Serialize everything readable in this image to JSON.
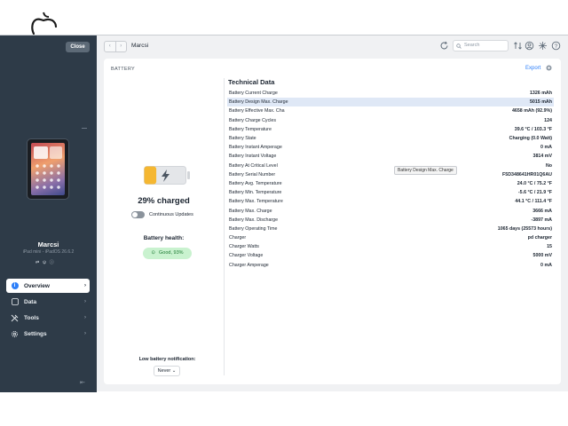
{
  "sidebar": {
    "close_label": "Close",
    "device_name": "Marcsi",
    "device_model": "iPad mini - iPadOS 26.6.2",
    "nav_items": [
      {
        "label": "Overview",
        "icon": "info-icon",
        "active": true
      },
      {
        "label": "Data",
        "icon": "data-icon",
        "active": false
      },
      {
        "label": "Tools",
        "icon": "tools-icon",
        "active": false
      },
      {
        "label": "Settings",
        "icon": "gear-icon",
        "active": false
      }
    ]
  },
  "topbar": {
    "breadcrumb": "Marcsi",
    "search_placeholder": "Search"
  },
  "battery": {
    "section_title": "BATTERY",
    "export_label": "Export",
    "charge_level": 0.29,
    "charged_label": "29% charged",
    "continuous_updates_label": "Continuous Updates",
    "continuous_updates_on": false,
    "health_label": "Battery health:",
    "health_value": "Good, 93%",
    "low_battery_label": "Low battery notification:",
    "low_battery_value": "Never",
    "accent_color": "#f5b731",
    "health_color": "#c9f2cf"
  },
  "technical": {
    "title": "Technical Data",
    "tooltip": "Battery Design Max. Charge",
    "rows": [
      {
        "label": "Battery Current Charge",
        "value": "1326 mAh"
      },
      {
        "label": "Battery Design Max. Charge",
        "value": "5015 mAh"
      },
      {
        "label": "Battery Effective Max. Cha",
        "value": "4658 mAh (92.9%)"
      },
      {
        "label": "Battery Charge Cycles",
        "value": "124"
      },
      {
        "label": "Battery Temperature",
        "value": "39.6 °C / 103.3 °F"
      },
      {
        "label": "Battery State",
        "value": "Charging (0.0 Watt)"
      },
      {
        "label": "Battery Instant Amperage",
        "value": "0 mA"
      },
      {
        "label": "Battery Instant Voltage",
        "value": "3814 mV"
      },
      {
        "label": "Battery At Critical Level",
        "value": "No"
      },
      {
        "label": "Battery Serial Number",
        "value": "F5D348641HR01Q6AU"
      },
      {
        "label": "Battery Avg. Temperature",
        "value": "24.0 °C / 75.2 °F"
      },
      {
        "label": "Battery Min. Temperature",
        "value": "-5.6 °C / 21.9 °F"
      },
      {
        "label": "Battery Max. Temperature",
        "value": "44.1 °C / 111.4 °F"
      },
      {
        "label": "Battery Max. Charge",
        "value": "3666 mA"
      },
      {
        "label": "Battery Max. Discharge",
        "value": "-3897 mA"
      },
      {
        "label": "Battery Operating Time",
        "value": "1065 days (25573 hours)"
      },
      {
        "label": "Charger",
        "value": "pd charger"
      },
      {
        "label": "Charger Watts",
        "value": "15"
      },
      {
        "label": "Charger Voltage",
        "value": "5000 mV"
      },
      {
        "label": "Charger Amperage",
        "value": "0 mA"
      }
    ]
  }
}
